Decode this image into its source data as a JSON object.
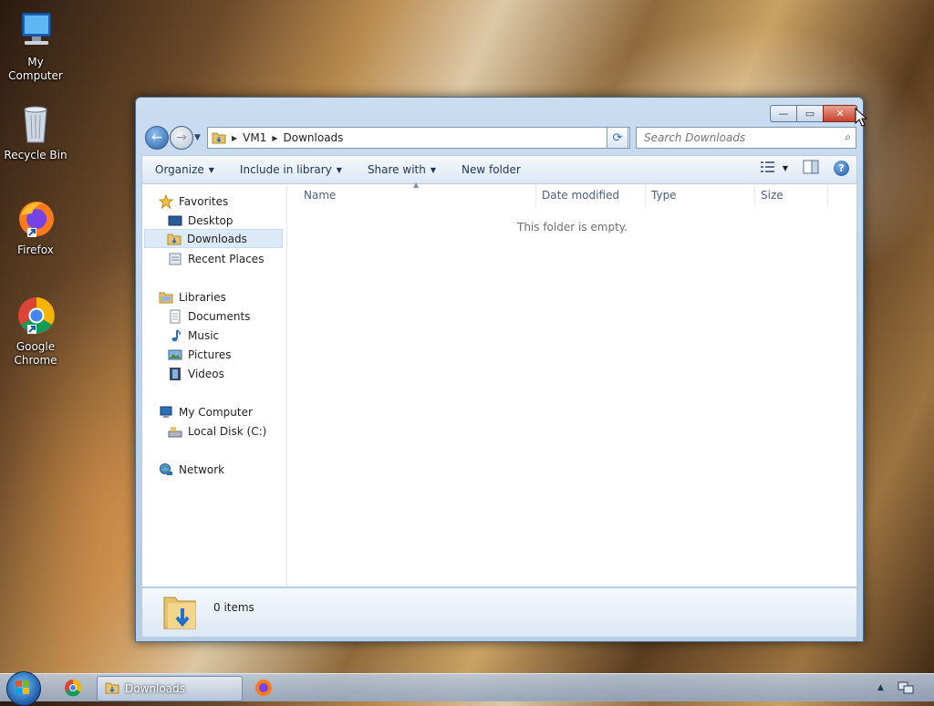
{
  "desktop": {
    "icons": [
      {
        "label": "My Computer"
      },
      {
        "label": "Recycle Bin"
      },
      {
        "label": "Firefox"
      },
      {
        "label": "Google Chrome"
      }
    ]
  },
  "window": {
    "controls": {
      "minimize": "—",
      "maximize": "▭",
      "close": "✕"
    },
    "address": {
      "segments": [
        "VM1",
        "Downloads"
      ]
    },
    "search": {
      "placeholder": "Search Downloads"
    },
    "toolbar": {
      "organize": "Organize",
      "include_in_library": "Include in library",
      "share_with": "Share with",
      "new_folder": "New folder"
    },
    "nav": {
      "favorites": "Favorites",
      "desktop": "Desktop",
      "downloads": "Downloads",
      "recent_places": "Recent Places",
      "libraries": "Libraries",
      "documents": "Documents",
      "music": "Music",
      "pictures": "Pictures",
      "videos": "Videos",
      "my_computer": "My Computer",
      "local_disk": "Local Disk (C:)",
      "network": "Network"
    },
    "columns": {
      "name": "Name",
      "date_modified": "Date modified",
      "type": "Type",
      "size": "Size"
    },
    "empty_message": "This folder is empty.",
    "status": {
      "items": "0 items"
    }
  },
  "taskbar": {
    "active_window": "Downloads"
  },
  "colors": {
    "accent": "#2a5fa8",
    "selection": "#dceaf7",
    "folder": "#e9c36a"
  }
}
